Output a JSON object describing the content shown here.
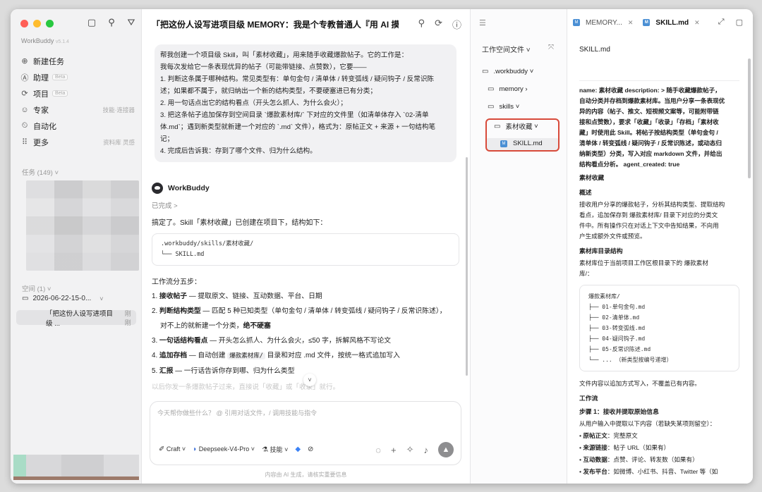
{
  "sidebar": {
    "brand": "WorkBuddy",
    "version": "v5.1.4",
    "nav": [
      {
        "icon": "plus-circle-icon",
        "glyph": "⊕",
        "label": "新建任务",
        "badge": "",
        "extra": ""
      },
      {
        "icon": "assistant-icon",
        "glyph": "Ⓐ",
        "label": "助理",
        "badge": "Beta",
        "extra": ""
      },
      {
        "icon": "project-icon",
        "glyph": "⟳",
        "label": "项目",
        "badge": "Beta",
        "extra": ""
      },
      {
        "icon": "expert-icon",
        "glyph": "☺",
        "label": "专家",
        "badge": "",
        "extra": "技能·连接器"
      },
      {
        "icon": "automation-icon",
        "glyph": "⏲",
        "label": "自动化",
        "badge": "",
        "extra": ""
      },
      {
        "icon": "more-icon",
        "glyph": "⠿",
        "label": "更多",
        "badge": "",
        "extra": "资料库 灵感"
      }
    ],
    "tasks_label": "任务 (149)",
    "spaces_label": "空间 (1)",
    "space_name": "2026-06-22-15-0...",
    "chat_item": "「把这份人设写进项目级 ...",
    "chat_time": "刚刚"
  },
  "main": {
    "title": "「把这份人设写进项目级 MEMORY：我是个专教普通人『用 AI 摸...",
    "user_message": [
      "帮我创建一个项目级 Skill，叫「素材收藏」，用来随手收藏爆款帖子。它的工作是：",
      "我每次发给它一条表现优异的帖子（可能带链接、点赞数），它要——",
      "1. 判断这条属于哪种结构。常见类型有：单句金句 / 清单体 / 转变弧线 / 疑问钩子 / 反常识陈",
      "述；如果都不属于，就归纳出一个新的结构类型，不要硬塞进已有分类；",
      "2. 用一句话点出它的结构看点（开头怎么抓人、为什么会火）；",
      "3. 把这条帖子追加保存到空间目录 `爆款素材库/` 下对应的文件里（如清单体存入 `02-清单",
      "体.md`；遇到新类型就新建一个对应的 `.md` 文件），格式为：原帖正文 + 来源 + 一句结构笔",
      "记；",
      "4. 完成后告诉我：存到了哪个文件、归为什么结构。"
    ],
    "assistant_name": "WorkBuddy",
    "status": "已完成 >",
    "reply_intro": "搞定了。Skill「素材收藏」已创建在项目下，结构如下：",
    "code_lines": [
      ".workbuddy/skills/素材收藏/",
      "└── SKILL.md"
    ],
    "steps_head": "工作流分五步：",
    "steps": [
      {
        "n": "1. ",
        "b": "接收帖子",
        "t": " — 提取原文、链接、互动数据、平台、日期",
        "tag": "",
        "t2": "",
        "b2": ""
      },
      {
        "n": "2. ",
        "b": "判断结构类型",
        "t": " — 匹配 5 种已知类型（单句金句 / 清单体 / 转变弧线 / 疑问钩子 / 反常识陈述），",
        "tag": "",
        "t2": "",
        "b2": ""
      },
      {
        "n": "",
        "b": "",
        "t": "对不上的就新建一个分类，",
        "tag": "",
        "t2": "",
        "b2": "绝不硬塞"
      },
      {
        "n": "3. ",
        "b": "一句话结构看点",
        "t": " — 开头怎么抓人、为什么会火，≤50 字，拆解风格不写论文",
        "tag": "",
        "t2": "",
        "b2": ""
      },
      {
        "n": "4. ",
        "b": "追加存档",
        "t": " — 自动创建 ",
        "tag": "爆款素材库/",
        "t2": " 目录和对应 .md 文件，按统一格式追加写入",
        "b2": ""
      },
      {
        "n": "5. ",
        "b": "汇报",
        "t": " — 一行话告诉你存到哪、归为什么类型",
        "tag": "",
        "t2": "",
        "b2": ""
      }
    ],
    "faded_line": "以后你发一条爆款帖子过来，直接说「收藏」或「收录」就行。",
    "composer_placeholder": "今天帮你做些什么？ @ 引用对话文件，/ 调用技能与指令",
    "tools": {
      "craft": "Craft",
      "model": "Deepseek-V4-Pro",
      "skills": "技能"
    },
    "disclaimer": "内容由 AI 生成，请核实重要信息"
  },
  "files": {
    "header": "工作空间文件",
    "tree": [
      {
        "label": ".workbuddy",
        "suffix": "˅"
      },
      {
        "label": "memory",
        "suffix": "›"
      },
      {
        "label": "skills",
        "suffix": "˅"
      },
      {
        "label": "素材收藏",
        "suffix": "˅"
      },
      {
        "label": "SKILL.md",
        "suffix": ""
      }
    ]
  },
  "editor": {
    "tabs": [
      {
        "label": "MEMORY...",
        "active": false
      },
      {
        "label": "SKILL.md",
        "active": true
      }
    ],
    "file_title": "SKILL.md",
    "meta": [
      "name: 素材收藏 description: > 随手收藏爆款帖子，",
      "自动分类并存档到爆款素材库。当用户分享一条表现优",
      "异的内容（帖子、推文、短视频文案等，可能附带链",
      "接和点赞数），要求「收藏」「收录」「存档」「素材收",
      "藏」时使用此 Skill。将帖子按结构类型（单句金句 /",
      "清单体 / 转变弧线 / 疑问钩子 / 反常识陈述，或动态归",
      "纳新类型）分类，写入对应 markdown 文件，并给出",
      "结构看点分析。 agent_created: true"
    ],
    "h1": "素材收藏",
    "h_overview": "概述",
    "overview": [
      "接收用户分享的爆款帖子，分析其结构类型、提取结构",
      "看点，追加保存到 爆款素材库/ 目录下对应的分类文",
      "件中。所有操作只在对话上下文中告知结果，不向用",
      "户生成额外文件或预览。"
    ],
    "h_lib": "素材库目录结构",
    "lib_desc": [
      "素材库位于当前项目工作区根目录下的 爆款素材",
      "库/："
    ],
    "lib_code": [
      "爆款素材库/",
      "├── 01-单句金句.md",
      "├── 02-清单体.md",
      "├── 03-转变弧线.md",
      "├── 04-疑问钩子.md",
      "├── 05-反常识陈述.md",
      "└── ... （新类型按编号递增）"
    ],
    "append_note": "文件内容以追加方式写入，不覆盖已有内容。",
    "h_flow": "工作流",
    "step1": "步骤 1：接收并提取原始信息",
    "step1_desc": "从用户输入中提取以下内容（若缺失某项则留空）：",
    "bullets": [
      {
        "b": "原帖正文",
        "t": "：完整原文"
      },
      {
        "b": "来源链接",
        "t": "：帖子 URL（如果有）"
      },
      {
        "b": "互动数据",
        "t": "：点赞、评论、转发数（如果有）"
      },
      {
        "b": "发布平台",
        "t": "：如微博、小红书、抖音、Twitter 等（如"
      }
    ]
  },
  "colors": {
    "close": "#ff5f57",
    "minimize": "#febc2e",
    "maximize": "#28c840",
    "highlight": "#d84a3a",
    "md_icon": "#4a8fd4"
  }
}
